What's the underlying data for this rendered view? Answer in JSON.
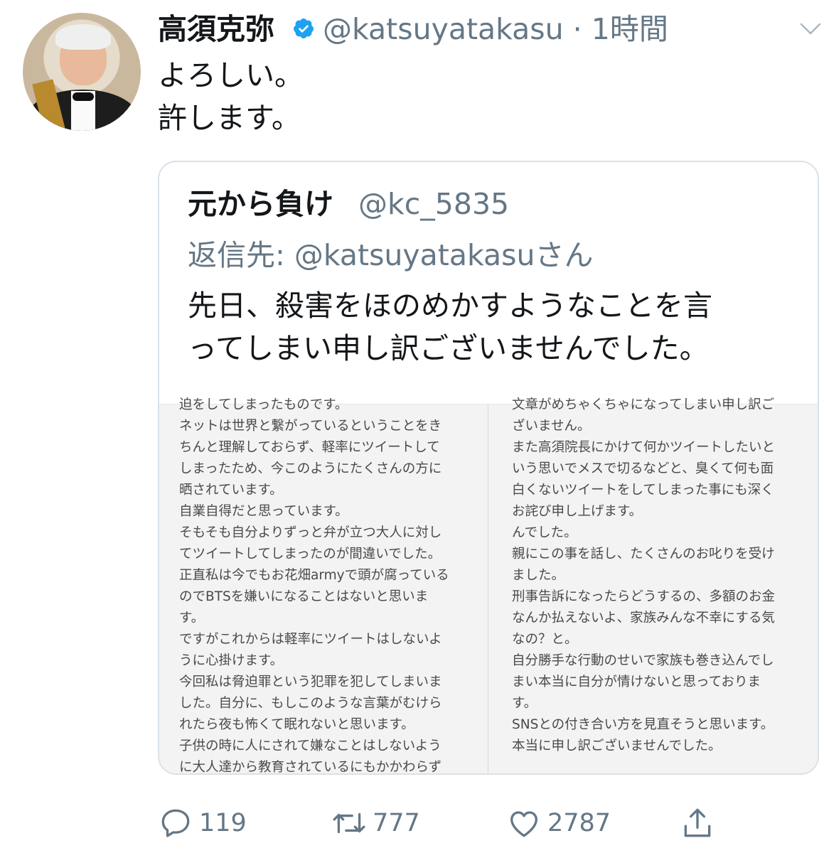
{
  "tweet": {
    "author_name": "高須克弥",
    "handle_time": "@katsuyatakasu · 1時間",
    "text_lines": [
      "よろしい。",
      "許します。"
    ]
  },
  "quoted": {
    "author_name": "元から負け",
    "handle": "@kc_5835",
    "reply_to": "返信先: @katsuyatakasuさん",
    "text_lines": [
      "先日、殺害をほのめかすようなことを言",
      "ってしまい申し訳ございませんでした。"
    ],
    "image": {
      "left_lines": [
        "迫をしてしまったものです。",
        "ネットは世界と繋がっているということをき",
        "ちんと理解しておらず、軽率にツイートして",
        "しまったため、今このようにたくさんの方に",
        "晒されています。",
        "自業自得だと思っています。",
        "そもそも自分よりずっと弁が立つ大人に対し",
        "てツイートしてしまったのが間違いでした。",
        "正直私は今でもお花畑armyで頭が腐っている",
        "のでBTSを嫌いになることはないと思いま",
        "す。",
        "ですがこれからは軽率にツイートはしないよ",
        "うに心掛けます。",
        "今回私は脅迫罪という犯罪を犯してしまいま",
        "した。自分に、もしこのような言葉がむけら",
        "れたら夜も怖くて眠れないと思います。",
        "子供の時に人にされて嫌なことはしないよう",
        "に大人達から教育されているにもかかわらず"
      ],
      "right_lines": [
        "文章がめちゃくちゃになってしまい申し訳ご",
        "ざいません。",
        "また高須院長にかけて何かツイートしたいと",
        "いう思いでメスで切るなどと、臭くて何も面",
        "白くないツイートをしてしまった事にも深く",
        "お詫び申し上げます。",
        "んでした。",
        "親にこの事を話し、たくさんのお叱りを受け",
        "ました。",
        "刑事告訴になったらどうするの、多額のお金",
        "なんか払えないよ、家族みんな不幸にする気",
        "なの？と。",
        "自分勝手な行動のせいで家族も巻き込んでし",
        "まい本当に自分が情けないと思っておりま",
        "す。",
        "SNSとの付き合い方を見直そうと思います。",
        "本当に申し訳ございませんでした。"
      ]
    }
  },
  "actions": {
    "reply_count": "119",
    "retweet_count": "777",
    "like_count": "2787"
  },
  "icons": {
    "verified": "verified-badge-icon",
    "menu": "chevron-down-icon",
    "reply": "reply-icon",
    "retweet": "retweet-icon",
    "like": "heart-icon",
    "share": "share-icon"
  },
  "colors": {
    "text": "#14171a",
    "secondary": "#657786",
    "verified": "#1da1f2",
    "border": "#d9e1e8"
  }
}
